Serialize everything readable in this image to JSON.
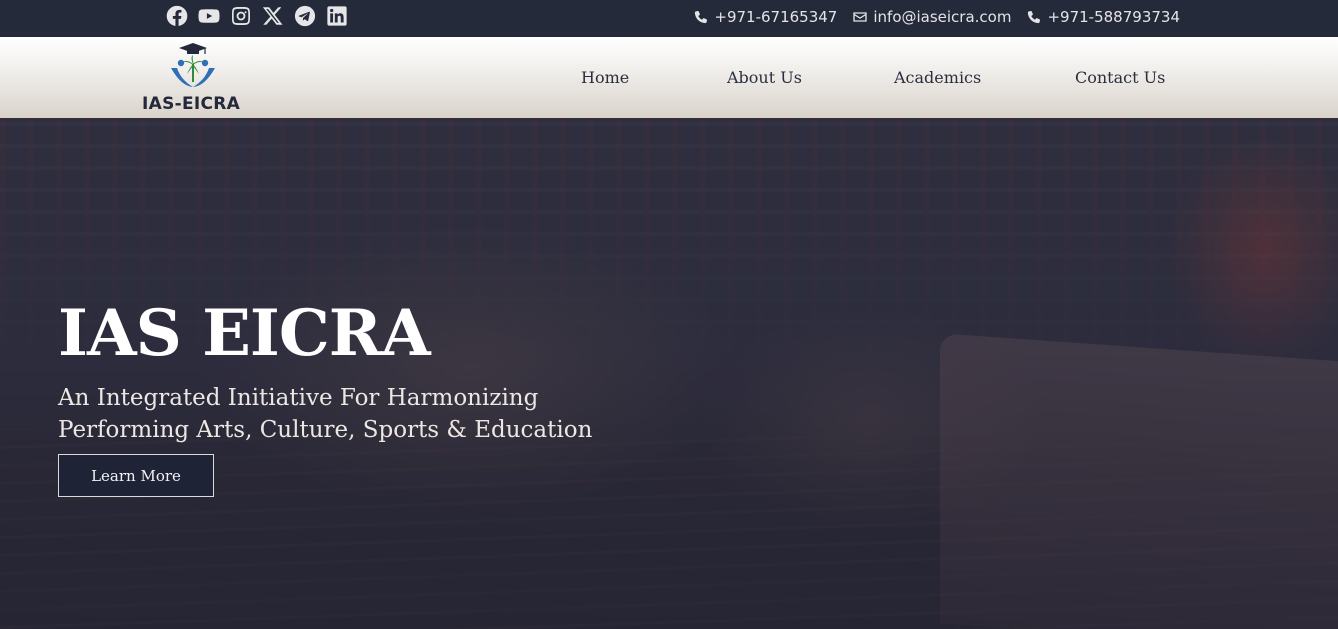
{
  "topbar": {
    "social_icons": [
      "facebook-icon",
      "youtube-icon",
      "instagram-icon",
      "x-icon",
      "telegram-icon",
      "linkedin-icon"
    ],
    "contacts": [
      {
        "icon": "phone-icon",
        "text": "+971-67165347"
      },
      {
        "icon": "mail-icon",
        "text": "info@iaseicra.com"
      },
      {
        "icon": "phone-icon",
        "text": "+971-588793734"
      }
    ]
  },
  "header": {
    "logo_text": "IAS-EICRA",
    "nav": [
      {
        "label": "Home"
      },
      {
        "label": "About Us"
      },
      {
        "label": "Academics"
      },
      {
        "label": "Contact Us"
      }
    ]
  },
  "hero": {
    "title": "IAS EICRA",
    "subtitle": "An Integrated Initiative For Harmonizing Performing Arts, Culture, Sports & Education",
    "button_label": "Learn More"
  },
  "colors": {
    "topbar_bg": "#252a3b",
    "header_gradient_end": "#d9d3ca",
    "button_bg": "#1f2336",
    "logo_blue": "#2f6fb5",
    "logo_green": "#2e8b3d"
  }
}
